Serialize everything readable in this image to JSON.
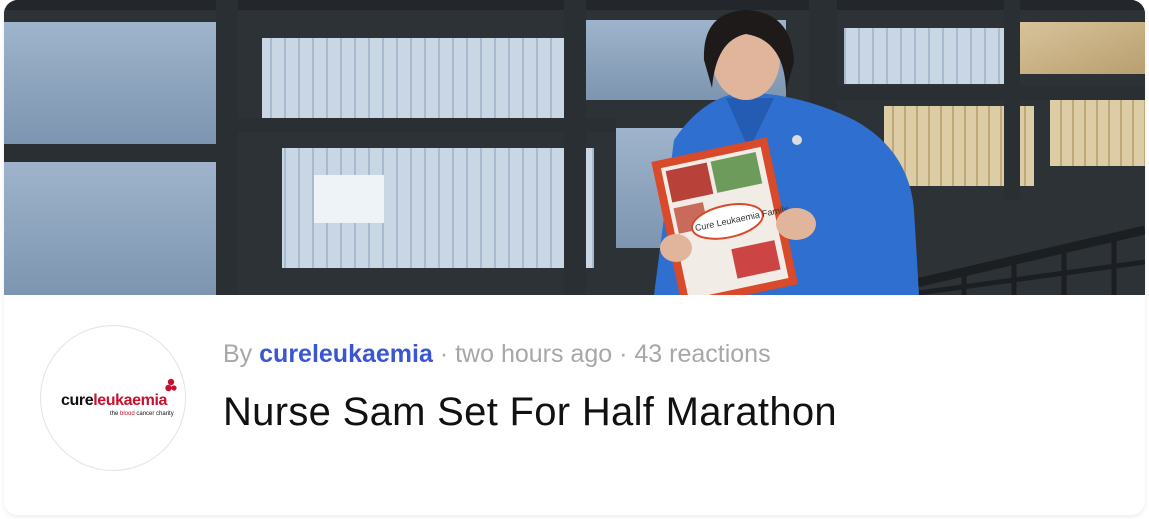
{
  "post": {
    "by_label": "By",
    "author": "cureleukaemia",
    "separator": "·",
    "time_ago": "two hours ago",
    "reactions": "43 reactions",
    "title": "Nurse Sam Set For Half Marathon"
  },
  "avatar": {
    "logo_cure": "cure",
    "logo_leukaemia": "leukaemia",
    "tagline_pre": "the",
    "tagline_accent": "blood",
    "tagline_post": "cancer charity"
  },
  "hero": {
    "booklet_label": "Cure Leukaemia Family"
  },
  "colors": {
    "author_link": "#3a56d4",
    "meta_text": "#a7a7a7",
    "title_text": "#111111",
    "brand_red": "#c8102e",
    "uniform_blue": "#2f6fd0"
  }
}
